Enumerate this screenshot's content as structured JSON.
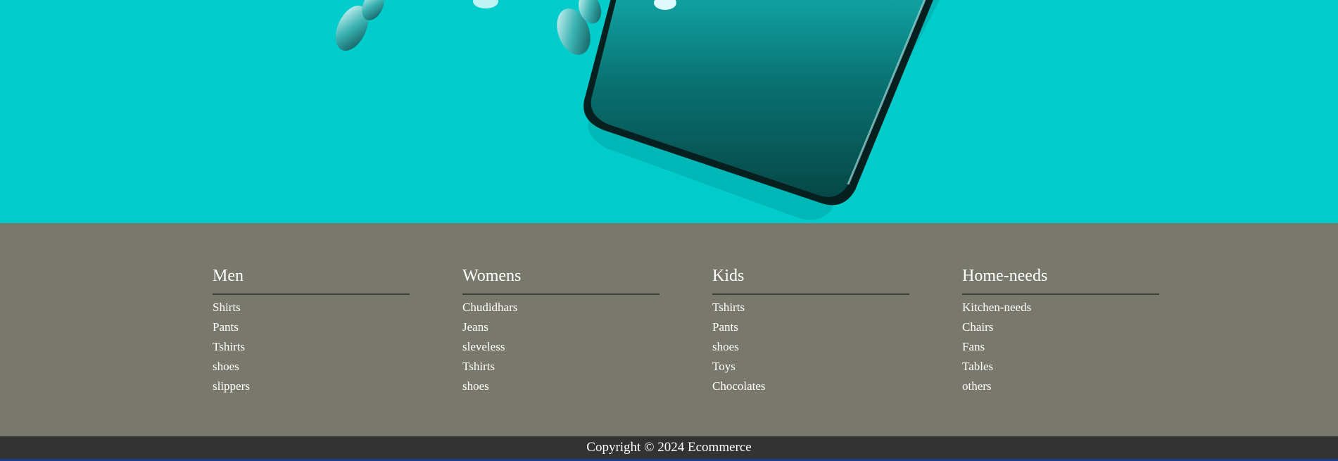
{
  "footer": {
    "columns": [
      {
        "title": "Men",
        "items": [
          "Shirts",
          "Pants",
          "Tshirts",
          "shoes",
          "slippers"
        ]
      },
      {
        "title": "Womens",
        "items": [
          "Chudidhars",
          "Jeans",
          "sleveless",
          "Tshirts",
          "shoes"
        ]
      },
      {
        "title": "Kids",
        "items": [
          "Tshirts",
          "Pants",
          "shoes",
          "Toys",
          "Chocolates"
        ]
      },
      {
        "title": "Home-needs",
        "items": [
          "Kitchen-needs",
          "Chairs",
          "Fans",
          "Tables",
          "others"
        ]
      }
    ]
  },
  "copyright": "Copyright © 2024 Ecommerce",
  "colors": {
    "hero_bg": "#00cccc",
    "footer_bg": "#79786c",
    "copyright_bg": "#333333"
  }
}
